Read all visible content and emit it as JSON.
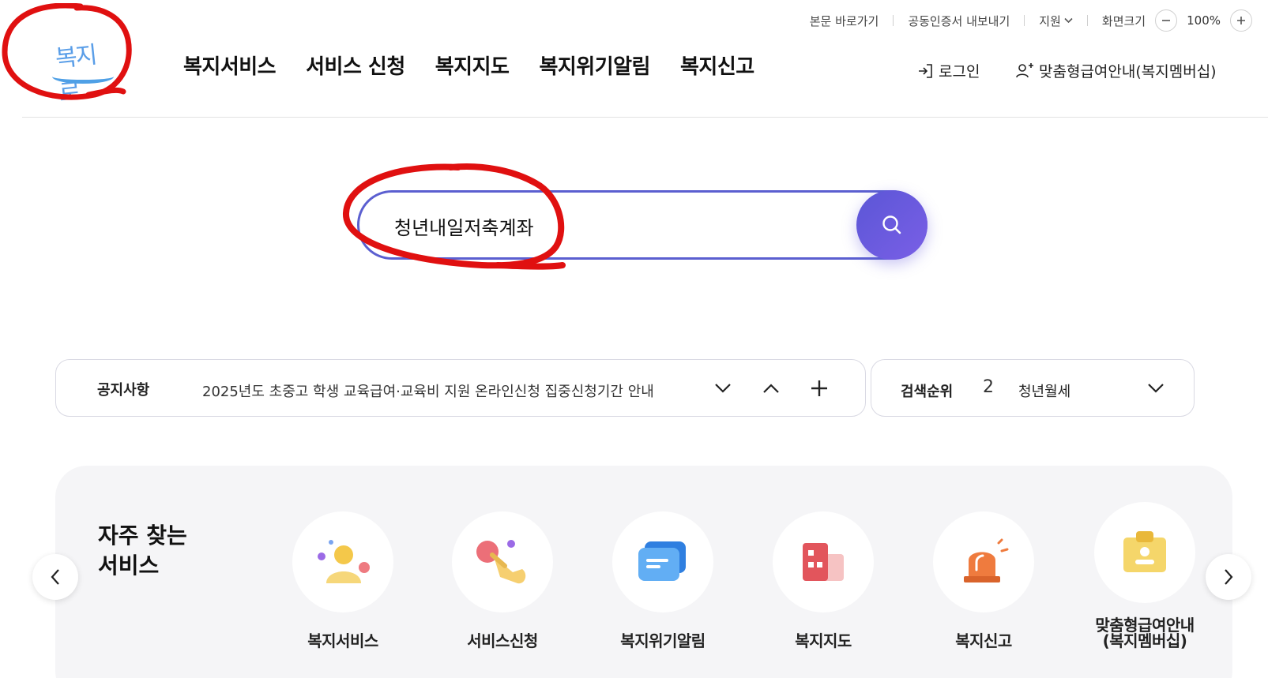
{
  "utility": {
    "skip_main": "본문 바로가기",
    "cert_export": "공동인증서 내보내기",
    "support": "지원",
    "screen_size": "화면크기",
    "zoom_level": "100%"
  },
  "logo": {
    "text": "복지로"
  },
  "gnb": {
    "items": [
      {
        "label": "복지서비스"
      },
      {
        "label": "서비스 신청"
      },
      {
        "label": "복지지도"
      },
      {
        "label": "복지위기알림"
      },
      {
        "label": "복지신고"
      }
    ]
  },
  "header": {
    "login_label": "로그인",
    "member_label": "맞춤형급여안내(복지멤버십)"
  },
  "search": {
    "value": "청년내일저축계좌"
  },
  "notice": {
    "title": "공지사항",
    "text": "2025년도 초중고 학생 교육급여·교육비 지원 온라인신청 집중신청기간 안내"
  },
  "ranking": {
    "title": "검색순위",
    "rank": "2",
    "term": "청년월세"
  },
  "frequent": {
    "title_line1": "자주 찾는",
    "title_line2": "서비스",
    "items": [
      {
        "label": "복지서비스",
        "icon": "person-icon"
      },
      {
        "label": "서비스신청",
        "icon": "tap-hand-icon"
      },
      {
        "label": "복지위기알림",
        "icon": "message-icon"
      },
      {
        "label": "복지지도",
        "icon": "building-icon"
      },
      {
        "label": "복지신고",
        "icon": "siren-icon"
      },
      {
        "label_line1": "맞춤형급여안내",
        "label_line2": "(복지멤버십)",
        "icon": "id-badge-icon"
      }
    ]
  },
  "colors": {
    "accent": "#5b5fd0",
    "annotation_red": "#e01010",
    "logo_blue": "#4fa0e6"
  }
}
